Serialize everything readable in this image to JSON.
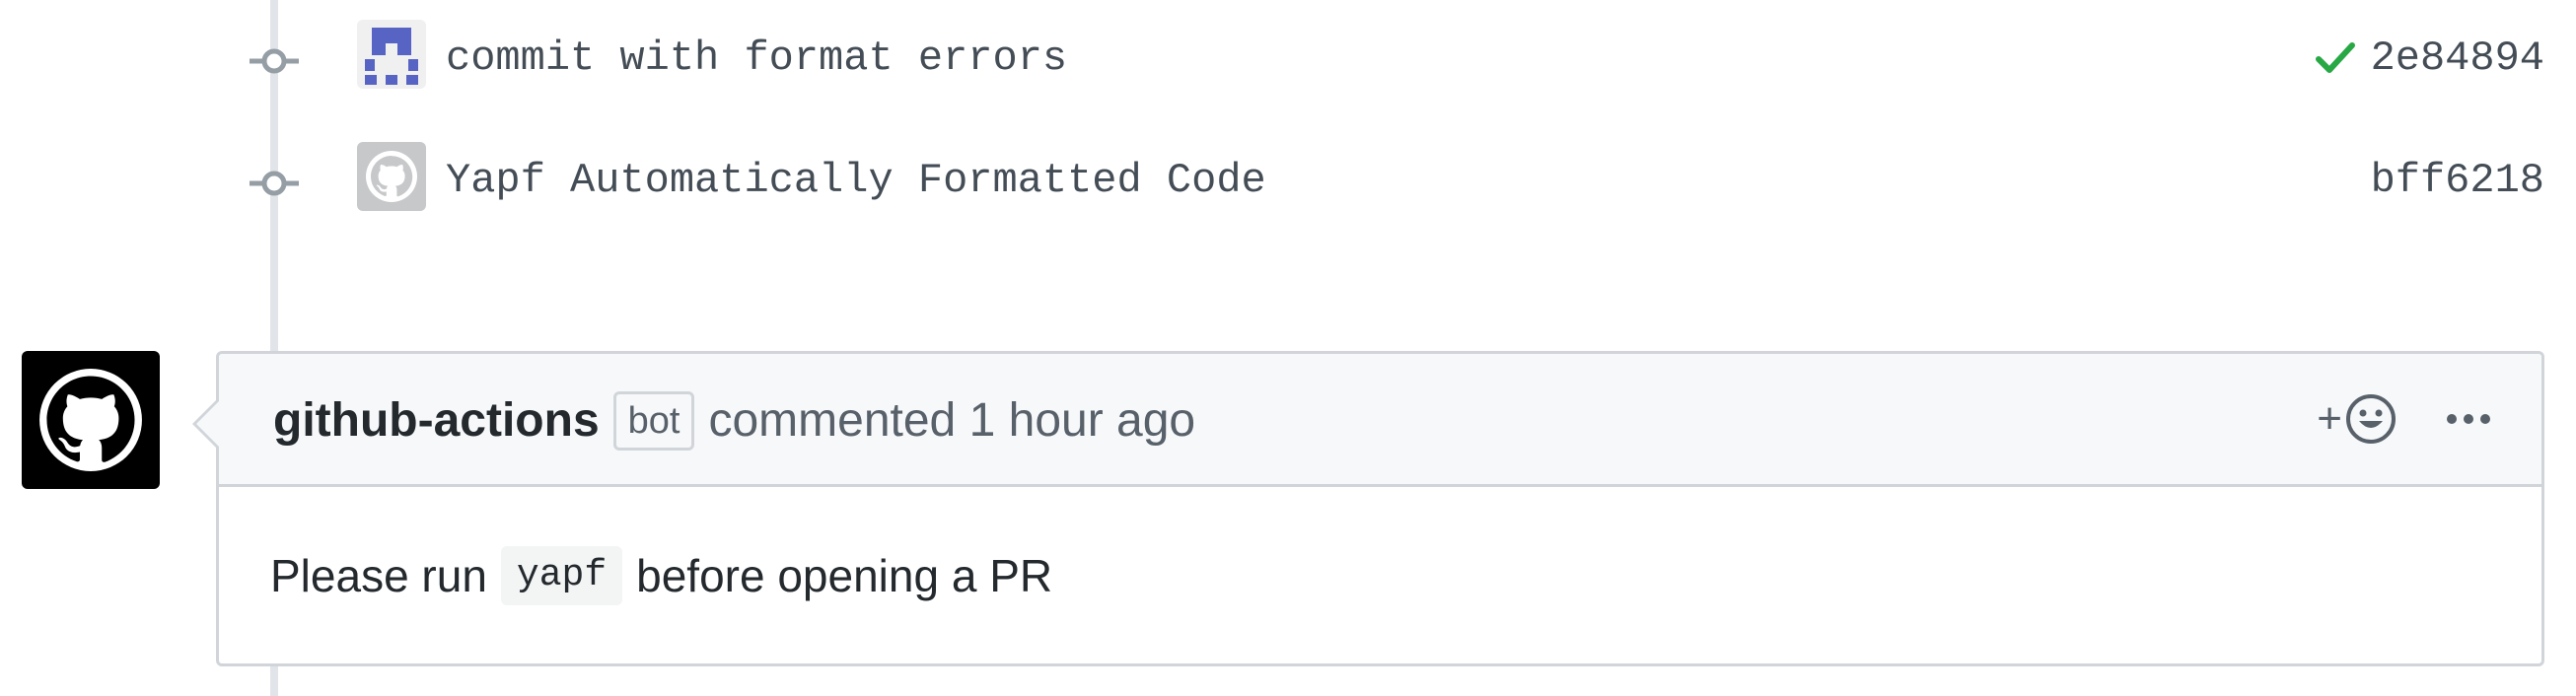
{
  "commits": [
    {
      "message": "commit with format errors",
      "sha": "2e84894",
      "status_icon": "check-icon",
      "status_color": "#28a745",
      "avatar": "identicon-avatar"
    },
    {
      "message": "Yapf Automatically Formatted Code",
      "sha": "bff6218",
      "avatar": "github-default-avatar"
    }
  ],
  "comment": {
    "author": "github-actions",
    "badge": "bot",
    "timestamp": "commented 1 hour ago",
    "reaction_label": "+",
    "body_before": "Please run",
    "body_code": "yapf",
    "body_after": "before opening a PR",
    "avatar": "github-actions-avatar"
  },
  "colors": {
    "text_primary": "#24292e",
    "text_muted": "#586069",
    "border": "#d1d5da",
    "header_bg": "#f6f8fa",
    "success": "#28a745",
    "identicon": "#5864c4"
  }
}
